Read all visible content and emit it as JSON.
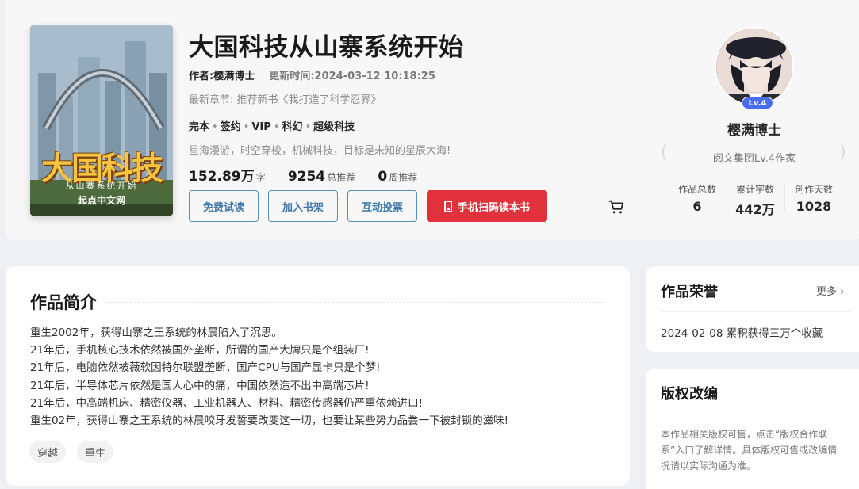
{
  "book": {
    "cover": {
      "title": "大国科技",
      "subtitle": "从山寨系统开始",
      "brand": "起点中文网"
    },
    "title": "大国科技从山寨系统开始",
    "author_label": "作者:樱满博士",
    "updated_label": "更新时间:2024-03-12 10:18:25",
    "latest_chapter": "最新章节: 推荐新书《我打造了科学忍界》",
    "tags": [
      "完本",
      "签约",
      "VIP",
      "科幻",
      "超级科技"
    ],
    "tag_separator": "•",
    "tagline": "星海漫游，时空穿梭，机械科技，目标是未知的星辰大海!",
    "stats": {
      "words_value": "152.89万",
      "words_unit": "字",
      "total_rec_value": "9254",
      "total_rec_unit": "总推荐",
      "weekly_rec_value": "0",
      "weekly_rec_unit": "周推荐"
    },
    "buttons": {
      "free_read": "免费试读",
      "add_shelf": "加入书架",
      "vote": "互动投票",
      "mobile_read": "手机扫码读本书"
    }
  },
  "author": {
    "level_badge": "Lv.4",
    "name": "樱满博士",
    "title": "阅文集团Lv.4作家",
    "stats": [
      {
        "label": "作品总数",
        "value": "6"
      },
      {
        "label": "累计字数",
        "value": "442万"
      },
      {
        "label": "创作天数",
        "value": "1028"
      }
    ]
  },
  "intro": {
    "title": "作品简介",
    "lines": [
      "重生2002年，获得山寨之王系统的林晨陷入了沉思。",
      "21年后，手机核心技术依然被国外垄断，所谓的国产大牌只是个组装厂!",
      "21年后，电脑依然被薇软因特尔联盟垄断，国产CPU与国产显卡只是个梦!",
      "21年后，半导体芯片依然是国人心中的痛，中国依然造不出中高端芯片!",
      "21年后，中高端机床、精密仪器、工业机器人、材料、精密传感器仍严重依赖进口!",
      "重生02年，获得山寨之王系统的林晨咬牙发誓要改变这一切，也要让某些势力品尝一下被封锁的滋味!"
    ],
    "chips": [
      "穿越",
      "重生"
    ]
  },
  "honors": {
    "title": "作品荣誉",
    "more": "更多",
    "items": [
      "2024-02-08 累积获得三万个收藏"
    ]
  },
  "copyright": {
    "title": "版权改编",
    "text": "本作品相关版权可售，点击“版权合作联系”入口了解详情。具体版权可售或改编情况请以实际沟通为准。"
  },
  "colors": {
    "accent_red": "#e0313d",
    "button_blue": "#3f78a8",
    "badge_blue": "#4a6cf0"
  }
}
